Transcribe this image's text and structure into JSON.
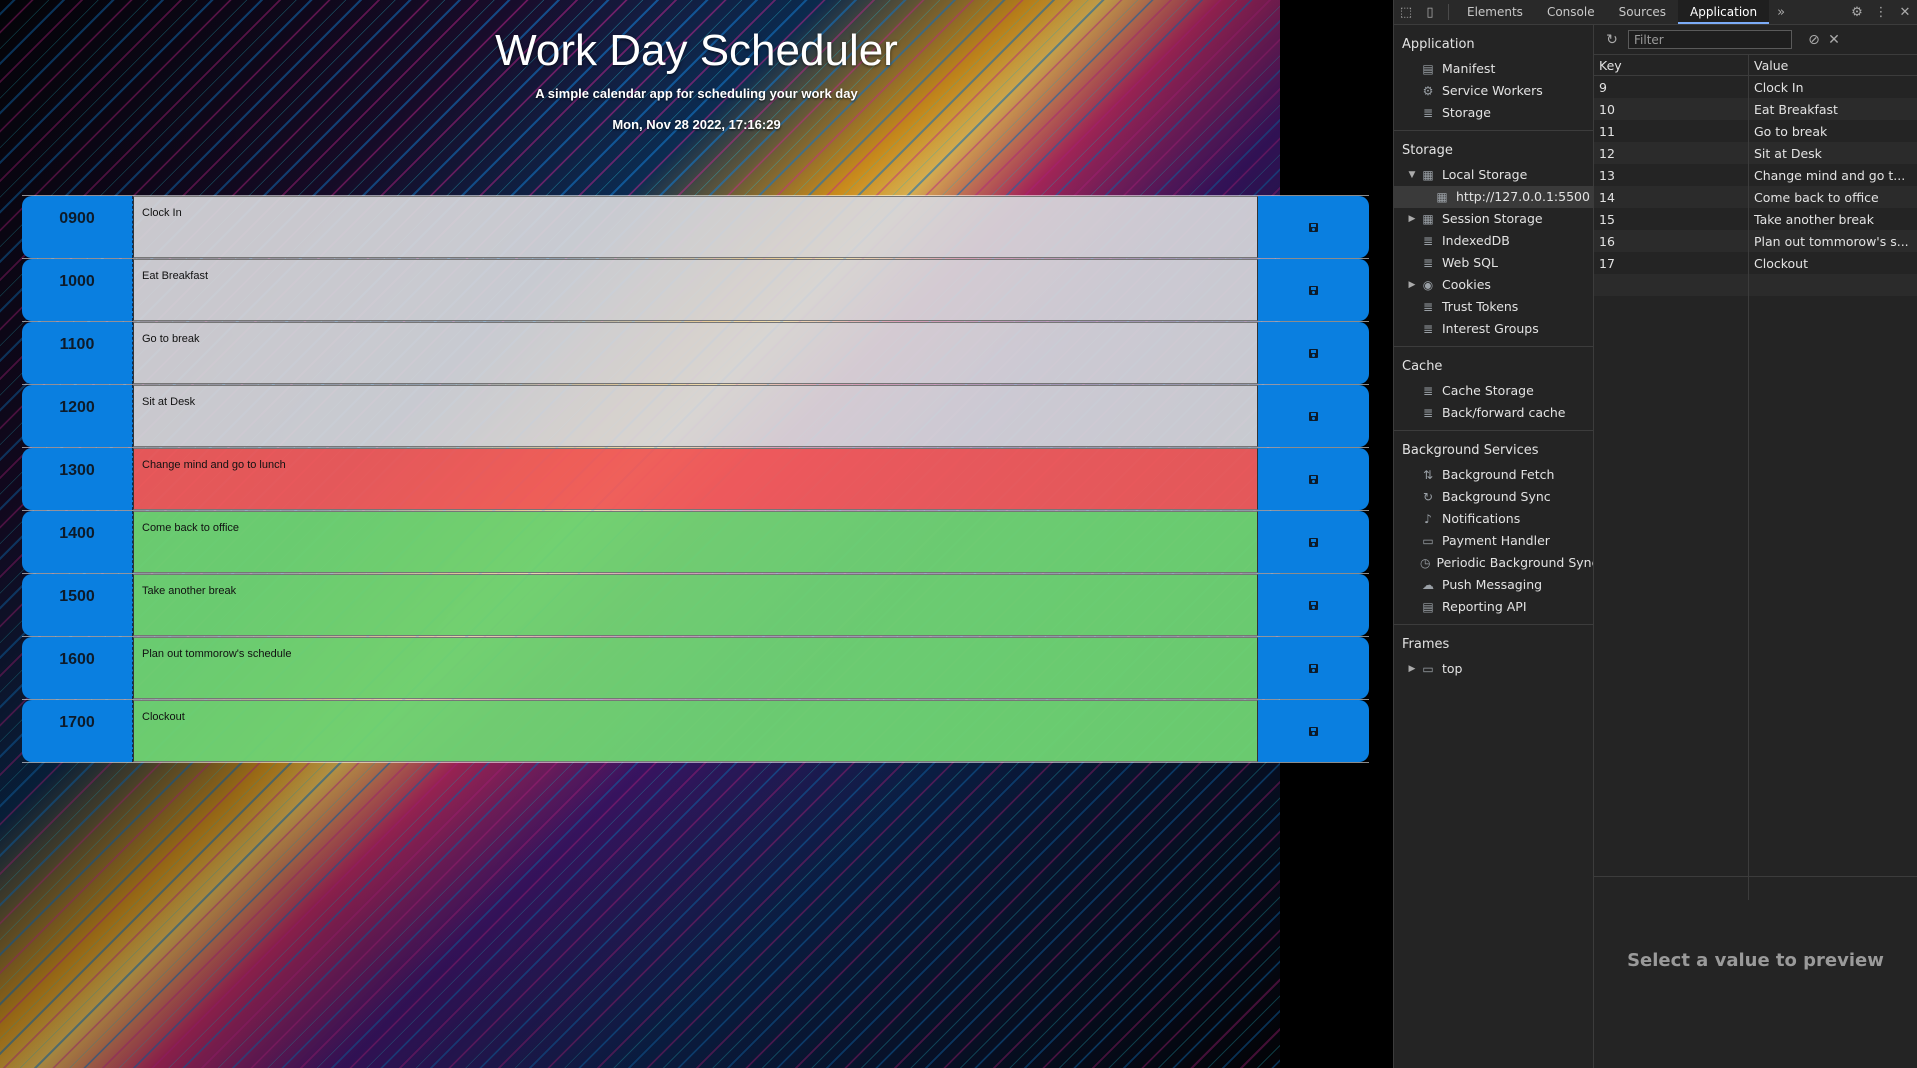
{
  "page": {
    "title": "Work Day Scheduler",
    "subtitle": "A simple calendar app for scheduling your work day",
    "datetime": "Mon, Nov 28 2022, 17:16:29"
  },
  "schedule": [
    {
      "hour": "0900",
      "text": "Clock In",
      "status": "past"
    },
    {
      "hour": "1000",
      "text": "Eat Breakfast",
      "status": "past"
    },
    {
      "hour": "1100",
      "text": "Go to break",
      "status": "past"
    },
    {
      "hour": "1200",
      "text": "Sit at Desk",
      "status": "past"
    },
    {
      "hour": "1300",
      "text": "Change mind and go to lunch",
      "status": "present"
    },
    {
      "hour": "1400",
      "text": "Come back to office",
      "status": "future"
    },
    {
      "hour": "1500",
      "text": "Take another break",
      "status": "future"
    },
    {
      "hour": "1600",
      "text": "Plan out tommorow's schedule",
      "status": "future"
    },
    {
      "hour": "1700",
      "text": "Clockout",
      "status": "future"
    }
  ],
  "colors": {
    "past": "#d7d7dc",
    "present": "#f05c5c",
    "future": "#6ed273",
    "accent": "#0a7fe0"
  },
  "devtools": {
    "tabs": [
      "Elements",
      "Console",
      "Sources",
      "Application"
    ],
    "active_tab": "Application",
    "more_tabs": "»",
    "sidebar": {
      "application": {
        "heading": "Application",
        "items": [
          {
            "label": "Manifest",
            "icon": "file-icon"
          },
          {
            "label": "Service Workers",
            "icon": "gear-icon"
          },
          {
            "label": "Storage",
            "icon": "database-icon"
          }
        ]
      },
      "storage": {
        "heading": "Storage",
        "local_storage": "Local Storage",
        "local_storage_origin": "http://127.0.0.1:5500",
        "session_storage": "Session Storage",
        "indexeddb": "IndexedDB",
        "websql": "Web SQL",
        "cookies": "Cookies",
        "trust_tokens": "Trust Tokens",
        "interest_groups": "Interest Groups"
      },
      "cache": {
        "heading": "Cache",
        "items": [
          {
            "label": "Cache Storage",
            "icon": "database-icon"
          },
          {
            "label": "Back/forward cache",
            "icon": "database-icon"
          }
        ]
      },
      "background_services": {
        "heading": "Background Services",
        "items": [
          {
            "label": "Background Fetch",
            "icon": "sort-arrows-icon"
          },
          {
            "label": "Background Sync",
            "icon": "sync-icon"
          },
          {
            "label": "Notifications",
            "icon": "bell-icon"
          },
          {
            "label": "Payment Handler",
            "icon": "card-icon"
          },
          {
            "label": "Periodic Background Sync",
            "icon": "clock-icon"
          },
          {
            "label": "Push Messaging",
            "icon": "cloud-icon"
          },
          {
            "label": "Reporting API",
            "icon": "file-icon"
          }
        ]
      },
      "frames": {
        "heading": "Frames",
        "top": "top"
      }
    },
    "filter_placeholder": "Filter",
    "table": {
      "key_header": "Key",
      "value_header": "Value",
      "rows": [
        {
          "key": "9",
          "value": "Clock In"
        },
        {
          "key": "10",
          "value": "Eat Breakfast"
        },
        {
          "key": "11",
          "value": "Go to break"
        },
        {
          "key": "12",
          "value": "Sit at Desk"
        },
        {
          "key": "13",
          "value": "Change mind and go t..."
        },
        {
          "key": "14",
          "value": "Come back to office"
        },
        {
          "key": "15",
          "value": "Take another break"
        },
        {
          "key": "16",
          "value": "Plan out tommorow's s..."
        },
        {
          "key": "17",
          "value": "Clockout"
        }
      ]
    },
    "preview_text": "Select a value to preview"
  }
}
